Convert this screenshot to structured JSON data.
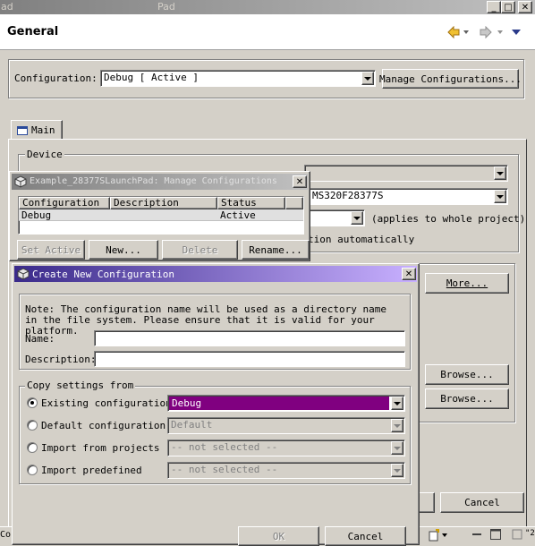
{
  "window": {
    "title_fragment_left": "ad",
    "title_fragment_right": "Pad"
  },
  "header": {
    "title": "General"
  },
  "configuration": {
    "label": "Configuration:",
    "value": "Debug  [ Active ]",
    "manage_button": "Manage Configurations..."
  },
  "tabs": [
    {
      "label": "Main"
    }
  ],
  "device_group": {
    "title": "Device",
    "partial_device": "MS320F28377S",
    "applies_text": "(applies to whole project)",
    "auto_text": "tion automatically",
    "more_button": "More...",
    "browse1": "Browse...",
    "browse2": "Browse..."
  },
  "manage_dialog": {
    "title": "Example_28377SLaunchPad: Manage Configurations",
    "columns": [
      "Configuration",
      "Description",
      "Status"
    ],
    "rows": [
      {
        "configuration": "Debug",
        "description": "",
        "status": "Active"
      }
    ],
    "buttons": {
      "set_active": "Set Active",
      "new": "New...",
      "delete": "Delete",
      "rename": "Rename..."
    }
  },
  "new_dialog": {
    "title": "Create New Configuration",
    "note": "Note: The configuration name will be used as a directory name in the file system.  Please ensure that it is valid for your platform.",
    "name_label": "Name:",
    "name_value": "",
    "description_label": "Description:",
    "description_value": "",
    "copy_group": "Copy settings from",
    "options": [
      {
        "label": "Existing configuration",
        "value": "Debug",
        "selected": true
      },
      {
        "label": "Default configuration",
        "value": "Default",
        "selected": false
      },
      {
        "label": "Import from projects",
        "value": "-- not selected --",
        "selected": false
      },
      {
        "label": "Import predefined",
        "value": "-- not selected --",
        "selected": false
      }
    ],
    "ok_button": "OK",
    "cancel_button": "Cancel"
  },
  "main_cancel_button": "Cancel",
  "bottom_left_fragment": "Co",
  "bottom_right_fragment": "\"2",
  "colors": {
    "title_active_start": "#0a246a",
    "title_active_end": "#a6caf0",
    "new_title_start": "#3a2a8a",
    "new_title_end": "#c8b0ff",
    "selection": "#800080"
  }
}
